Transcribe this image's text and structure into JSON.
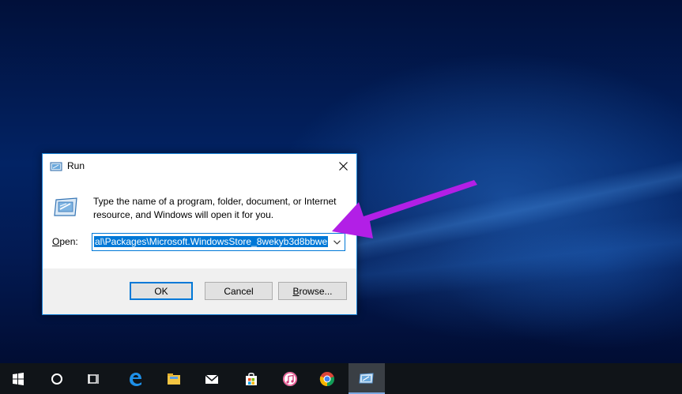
{
  "dialog": {
    "title": "Run",
    "description": "Type the name of a program, folder, document, or Internet resource, and Windows will open it for you.",
    "open_label_accel": "O",
    "open_label_rest": "pen:",
    "command_value": "al\\Packages\\Microsoft.WindowsStore_8wekyb3d8bbwe",
    "buttons": {
      "ok": "OK",
      "cancel": "Cancel",
      "browse_accel": "B",
      "browse_rest": "rowse..."
    }
  },
  "taskbar": {
    "items": [
      "start-icon",
      "cortana-icon",
      "task-view-icon",
      "edge-icon",
      "file-explorer-icon",
      "mail-icon",
      "store-icon",
      "itunes-icon",
      "chrome-icon",
      "run-icon"
    ],
    "active_item": "run-icon"
  },
  "colors": {
    "accent": "#0078d7",
    "annotation_arrow": "#b21fe6",
    "taskbar": "#101418"
  }
}
